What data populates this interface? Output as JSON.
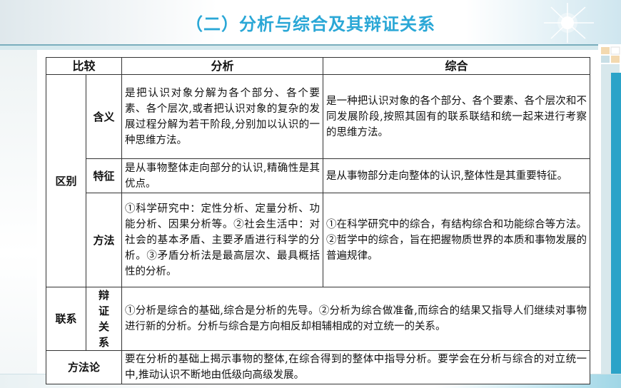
{
  "title": "（二）分析与综合及其辩证关系",
  "table": {
    "header": {
      "col_compare": "比较",
      "col_analysis": "分析",
      "col_synthesis": "综合"
    },
    "group_difference": "区别",
    "group_connection": "联系",
    "rows": {
      "meaning": {
        "label": "含义",
        "analysis": "是把认识对象分解为各个部分、各个要素、各个层次,或者把认识对象的复杂的发展过程分解为若干阶段,分别加以认识的一种思维方法。",
        "synthesis": "是一种把认识对象的各个部分、各个要素、各个层次和不同发展阶段,按照其固有的联系联结和统一起来进行考察的思维方法。"
      },
      "feature": {
        "label": "特征",
        "analysis": "是从事物整体走向部分的认识,精确性是其优点。",
        "synthesis": "是从事物部分走向整体的认识,整体性是其重要特征。"
      },
      "method": {
        "label": "方法",
        "analysis": "①科学研究中：定性分析、定量分析、功能分析、因果分析等。②社会生活中：对社会的基本矛盾、主要矛盾进行科学的分析。③矛盾分析法是最高层次、最具概括性的分析。",
        "synthesis": "①在科学研究中的综合，有结构综合和功能综合等方法。②哲学中的综合，旨在把握物质世界的本质和事物发展的普遍规律。"
      },
      "dialectic": {
        "label": "辩证关系",
        "content": "①分析是综合的基础,综合是分析的先导。②分析为综合做准备,而综合的结果又指导人们继续对事物进行新的分析。分析与综合是方向相反却相辅相成的对立统一的关系。"
      },
      "methodology": {
        "label": "方法论",
        "content": "要在分析的基础上揭示事物的整体,在综合得到的整体中指导分析。要学会在分析与综合的对立统一中,推动认识不断地由低级向高级发展。"
      }
    }
  },
  "colors": {
    "title": "#2aa7d6",
    "border": "#333333",
    "accent": "#7aaebd"
  }
}
